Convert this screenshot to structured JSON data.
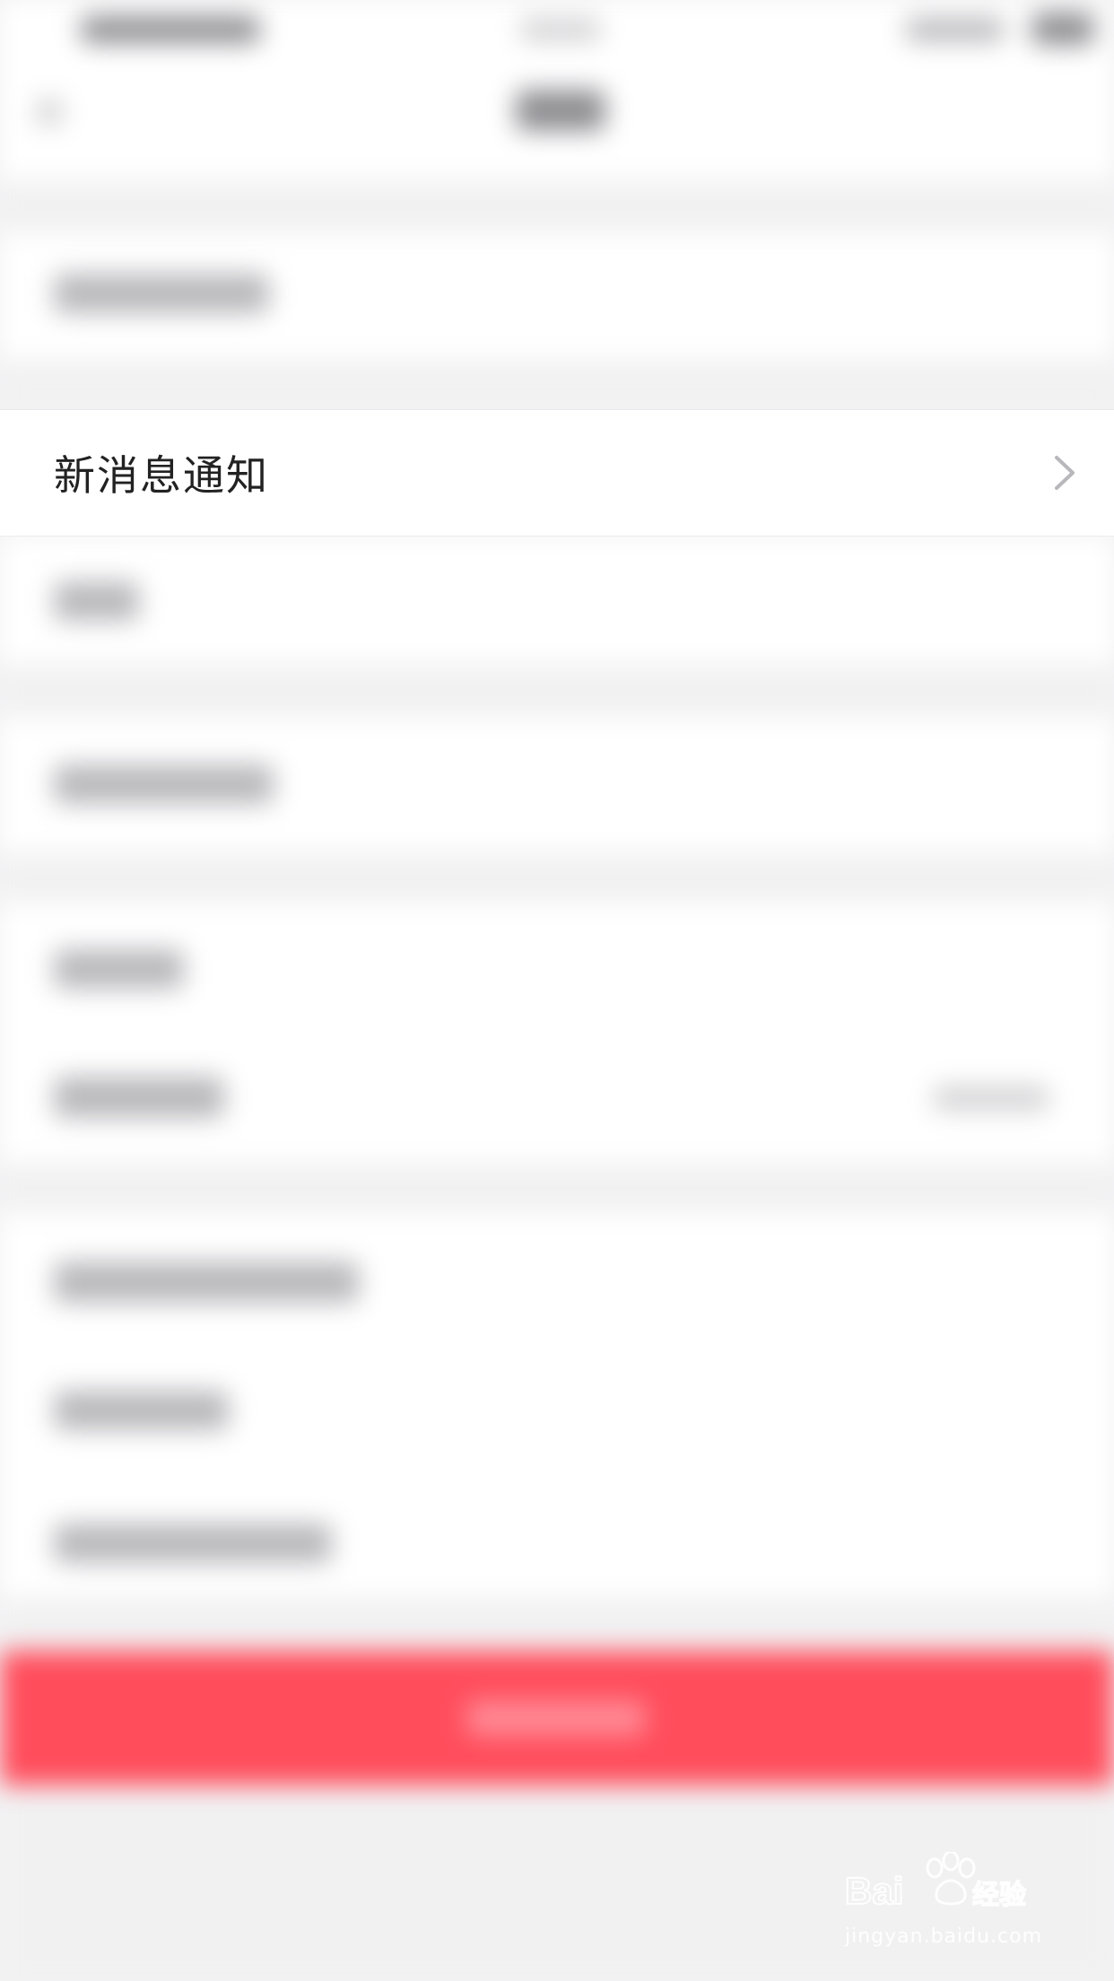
{
  "settings": {
    "focused_item": {
      "label": "新消息通知",
      "icon": "chevron-right-icon"
    }
  },
  "watermark": {
    "brand_text": "Baidu经验",
    "url": "jingyan.baidu.com"
  },
  "colors": {
    "primary_red": "#ff4d5c",
    "background": "#f3f3f4",
    "row_background": "#ffffff",
    "text": "#222222",
    "chevron": "#b8b8bc"
  }
}
